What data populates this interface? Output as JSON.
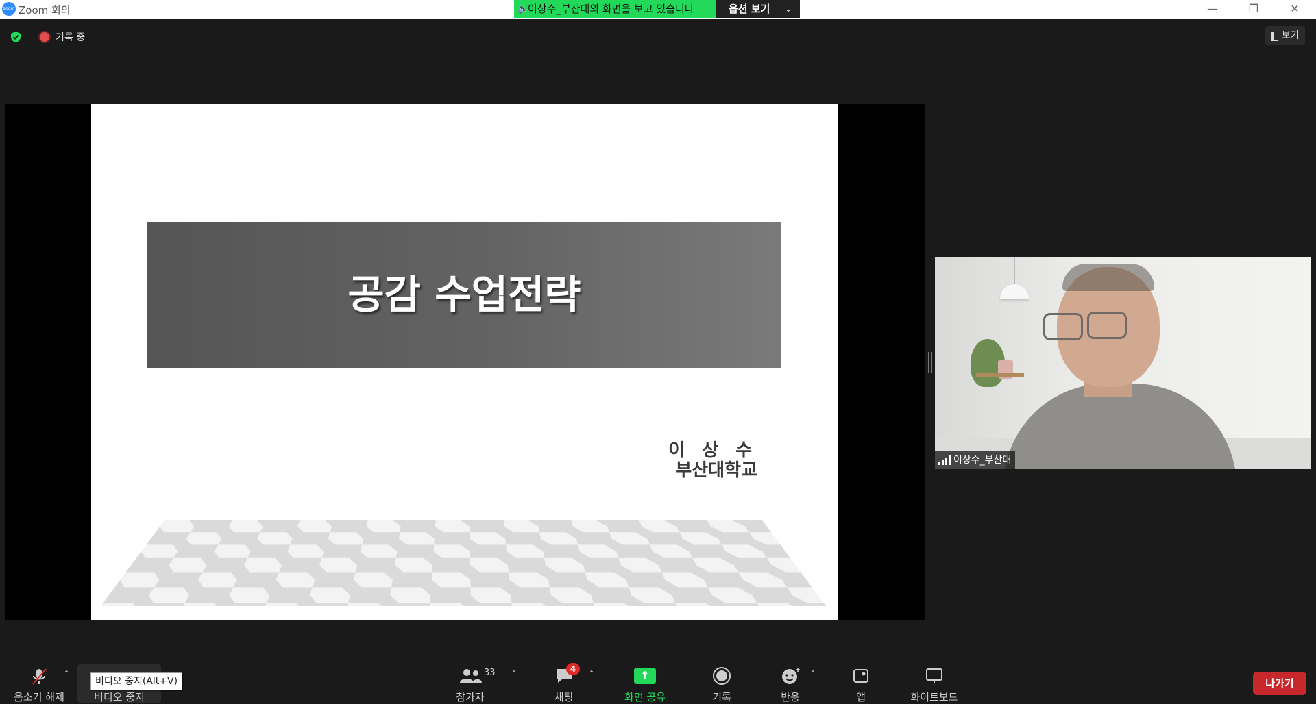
{
  "window": {
    "title": "Zoom 회의",
    "sharing_banner": "이상수_부산대의 화면을 보고 있습니다",
    "view_options": "옵션 보기",
    "minimize": "—",
    "restore": "❐",
    "close": "✕"
  },
  "status": {
    "recording": "기록 중",
    "view_button": "보기"
  },
  "slide": {
    "title": "공감 수업전략",
    "presenter_name": "이 상 수",
    "presenter_org": "부산대학교"
  },
  "participant": {
    "name": "이상수_부산대"
  },
  "toolbar": {
    "unmute": "음소거 해제",
    "stop_video": "비디오 중지",
    "stop_video_tooltip": "비디오 중지(Alt+V)",
    "participants": "참가자",
    "participants_count": "33",
    "chat": "채팅",
    "chat_badge": "4",
    "share_screen": "화면 공유",
    "record": "기록",
    "reactions": "반응",
    "apps": "앱",
    "whiteboard": "화이트보드",
    "leave": "나가기"
  },
  "colors": {
    "accent_green": "#23d959",
    "leave_red": "#c6282b",
    "badge_red": "#e02828"
  }
}
